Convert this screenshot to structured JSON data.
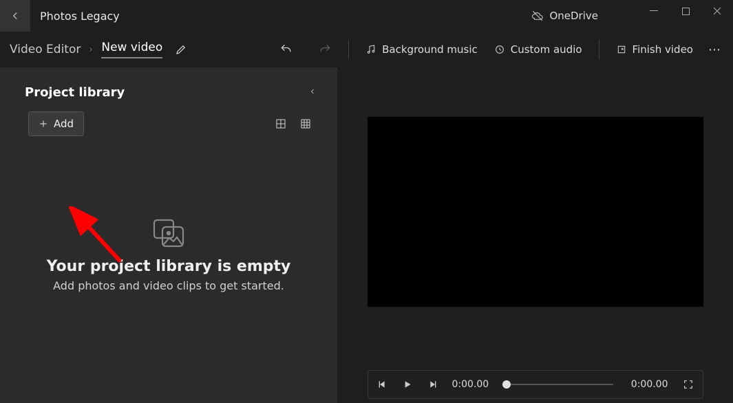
{
  "app": {
    "title": "Photos Legacy"
  },
  "onedrive": {
    "label": "OneDrive"
  },
  "breadcrumb": {
    "root": "Video Editor",
    "current": "New video"
  },
  "toolbar": {
    "bg_music": "Background music",
    "custom_audio": "Custom audio",
    "finish": "Finish video"
  },
  "library": {
    "title": "Project library",
    "add_label": "Add",
    "empty_title": "Your project library is empty",
    "empty_sub": "Add photos and video clips to get started."
  },
  "player": {
    "current_time": "0:00.00",
    "total_time": "0:00.00"
  }
}
